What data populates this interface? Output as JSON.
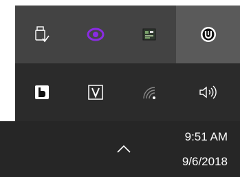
{
  "tray": {
    "row1": [
      {
        "icon": "usb-safely-remove-icon"
      },
      {
        "icon": "purple-eye-app-icon",
        "color": "#8a2be2"
      },
      {
        "icon": "circuit-board-app-icon"
      },
      {
        "icon": "circled-u-app-icon"
      }
    ],
    "row2": [
      {
        "icon": "bitwarden-b-icon"
      },
      {
        "icon": "v-app-icon",
        "label": "V"
      },
      {
        "icon": "wifi-icon"
      },
      {
        "icon": "speaker-volume-icon"
      }
    ]
  },
  "taskbar": {
    "chevron_icon": "chevron-up-icon",
    "clock": {
      "time": "9:51 AM",
      "date": "9/6/2018"
    }
  },
  "colors": {
    "flyout_top": "#434343",
    "flyout_bottom": "#2b2b2b",
    "taskbar": "#262626",
    "selected_cell": "#5a5a5a",
    "accent_purple": "#8a2be2"
  }
}
